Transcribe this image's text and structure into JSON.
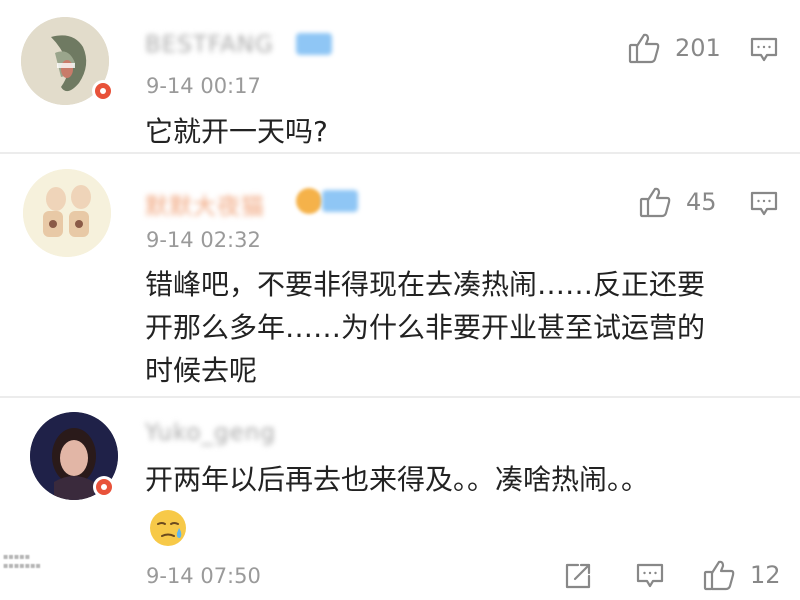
{
  "comments": [
    {
      "username": "BESTFANG",
      "timestamp": "9-14 00:17",
      "text_lines": [
        "它就开一天吗?"
      ],
      "like_count": "201"
    },
    {
      "username": "默默大夜猫",
      "timestamp": "9-14 02:32",
      "text_lines": [
        "错峰吧，不要非得现在去凑热闹……反正还要",
        "开那么多年……为什么非要开业甚至试运营的",
        "时候去呢"
      ],
      "like_count": "45"
    },
    {
      "username": "Yuko_geng",
      "timestamp": "9-14 07:50",
      "text_lines": [
        "开两年以后再去也来得及。。凑啥热闹。。"
      ],
      "emoji": "downcast-sweat-face-emoji",
      "like_count": "12"
    }
  ],
  "icons": {
    "like": "thumbs-up-icon",
    "reply": "comment-bubble-icon",
    "share": "share-icon",
    "verified": "verified-badge-icon"
  },
  "colors": {
    "username_gray": "#a8a8a8",
    "username_orange": "#f0a37a",
    "timestamp": "#9a9a9a",
    "text": "#222222",
    "icon": "#888888",
    "badge_red": "#e8523a",
    "level_blue": "#8fc6f5"
  }
}
